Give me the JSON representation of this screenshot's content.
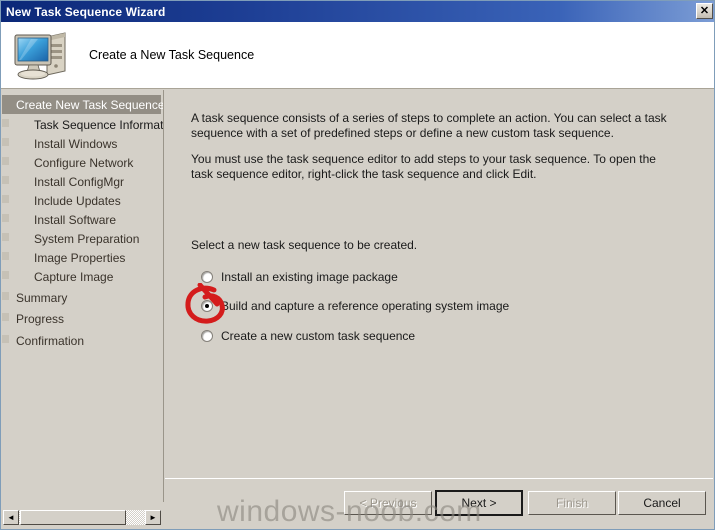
{
  "window": {
    "title": "New Task Sequence Wizard",
    "close_label": "✕"
  },
  "header": {
    "title": "Create a New Task Sequence",
    "icon": "computer-icon"
  },
  "sidebar": {
    "items": [
      {
        "label": "Create New Task Sequence",
        "level": 0,
        "state": "selected"
      },
      {
        "label": "Task Sequence Information",
        "level": 1,
        "state": "current"
      },
      {
        "label": "Install Windows",
        "level": 1,
        "state": "normal"
      },
      {
        "label": "Configure Network",
        "level": 1,
        "state": "normal"
      },
      {
        "label": "Install ConfigMgr",
        "level": 1,
        "state": "normal"
      },
      {
        "label": "Include Updates",
        "level": 1,
        "state": "normal"
      },
      {
        "label": "Install Software",
        "level": 1,
        "state": "normal"
      },
      {
        "label": "System Preparation",
        "level": 1,
        "state": "normal"
      },
      {
        "label": "Image Properties",
        "level": 1,
        "state": "normal"
      },
      {
        "label": "Capture Image",
        "level": 1,
        "state": "normal"
      },
      {
        "label": "Summary",
        "level": 0,
        "state": "normal"
      },
      {
        "label": "Progress",
        "level": 0,
        "state": "normal"
      },
      {
        "label": "Confirmation",
        "level": 0,
        "state": "normal"
      }
    ],
    "scrollbar": {
      "left_arrow": "◄",
      "right_arrow": "►"
    }
  },
  "content": {
    "paragraph1": "A task sequence consists of a series of steps to complete an action. You can select a task sequence with a set of predefined steps or define a new custom task sequence.",
    "paragraph2": "You must use the task sequence editor to add steps to your task sequence. To open the task sequence editor, right-click the task sequence and click Edit.",
    "prompt": "Select a new task sequence to be created.",
    "options": [
      {
        "label": "Install an existing image package",
        "selected": false
      },
      {
        "label": "Build and capture a reference operating system image",
        "selected": true
      },
      {
        "label": "Create a new custom task sequence",
        "selected": false
      }
    ]
  },
  "annotation": {
    "shape": "hand-drawn-red-circle",
    "color": "#d41c1c",
    "target": "Build and capture a reference operating system image"
  },
  "buttons": [
    {
      "label": "< Previous",
      "state": "disabled"
    },
    {
      "label": "Next >",
      "state": "default"
    },
    {
      "label": "Finish",
      "state": "disabled"
    },
    {
      "label": "Cancel",
      "state": "enabled"
    }
  ],
  "watermark": {
    "text": "windows-noob.com"
  },
  "colors": {
    "titlebar_start": "#0b2878",
    "titlebar_end": "#7d9ed6",
    "dialog_face": "#d4d0c8",
    "selection": "#938e85",
    "annotation_red": "#d41c1c"
  }
}
